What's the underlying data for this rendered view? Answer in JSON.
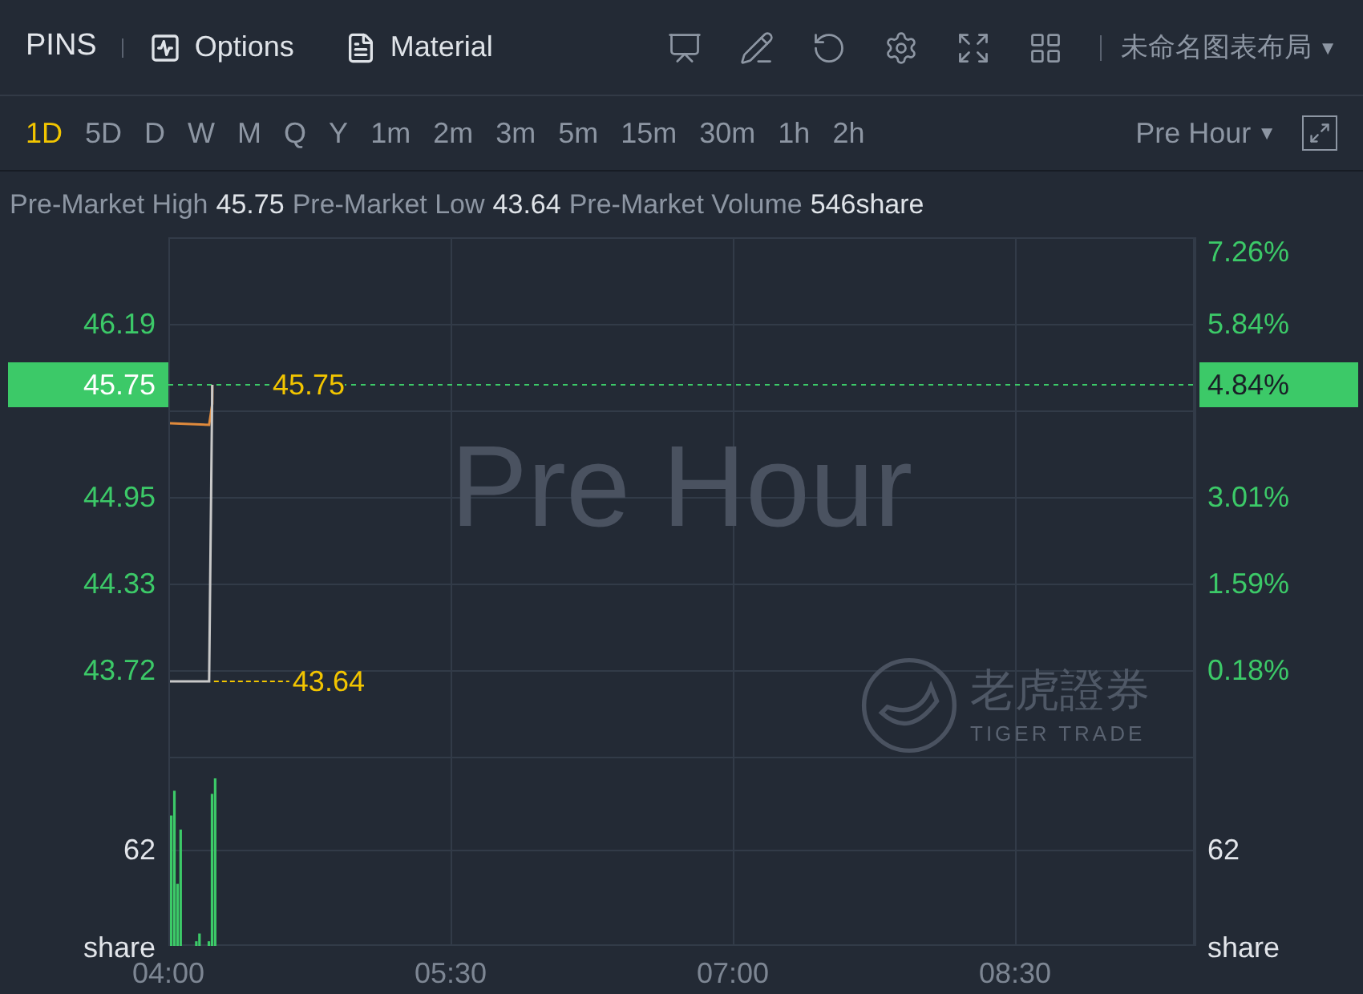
{
  "header": {
    "symbol": "PINS",
    "buttons": [
      {
        "label": "Options",
        "kind": "options"
      },
      {
        "label": "Material",
        "kind": "material"
      }
    ],
    "layout_name": "未命名图表布局",
    "layout_caret": "▼"
  },
  "timeframes": [
    {
      "label": "1D",
      "selected": true
    },
    {
      "label": "5D",
      "selected": false
    },
    {
      "label": "D",
      "selected": false
    },
    {
      "label": "W",
      "selected": false
    },
    {
      "label": "M",
      "selected": false
    },
    {
      "label": "Q",
      "selected": false
    },
    {
      "label": "Y",
      "selected": false
    },
    {
      "label": "1m",
      "selected": false
    },
    {
      "label": "2m",
      "selected": false
    },
    {
      "label": "3m",
      "selected": false
    },
    {
      "label": "5m",
      "selected": false
    },
    {
      "label": "15m",
      "selected": false
    },
    {
      "label": "30m",
      "selected": false
    },
    {
      "label": "1h",
      "selected": false
    },
    {
      "label": "2h",
      "selected": false
    }
  ],
  "session": {
    "label": "Pre Hour",
    "caret": "▼"
  },
  "stats": [
    {
      "label": "Pre-Market High",
      "value": "45.75"
    },
    {
      "label": "Pre-Market Low",
      "value": "43.64"
    },
    {
      "label": "Pre-Market Volume",
      "value": "546share"
    }
  ],
  "chart": {
    "watermark": "Pre Hour",
    "brand": "老虎證券",
    "brand_sub": "TIGER TRADE",
    "current_price": "45.75",
    "current_pct": "4.84%",
    "high_label": "45.75",
    "low_label": "43.64",
    "left_axis": {
      "price_ticks": [
        "46.19",
        "44.95",
        "44.33",
        "43.72"
      ],
      "volume_tick": "62",
      "volume_unit": "share"
    },
    "right_axis": {
      "pct_ticks": [
        "7.26%",
        "5.84%",
        "3.01%",
        "1.59%",
        "0.18%"
      ],
      "volume_tick": "62",
      "volume_unit": "share"
    },
    "time_ticks": [
      "04:00",
      "05:30",
      "07:00",
      "08:30"
    ]
  }
}
